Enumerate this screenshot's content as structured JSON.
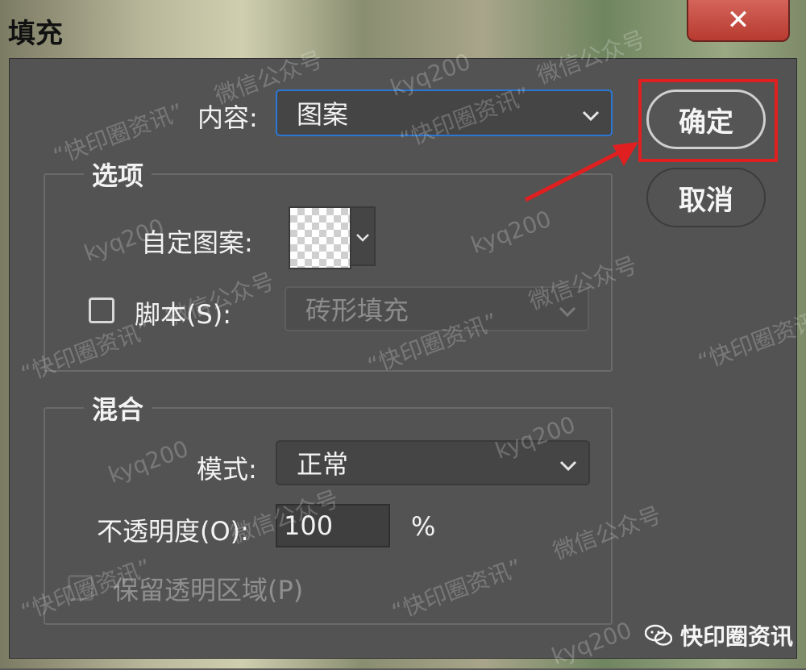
{
  "window": {
    "title": "填充",
    "close_symbol": "✕"
  },
  "content": {
    "label": "内容:",
    "value": "图案"
  },
  "options": {
    "group_title": "选项",
    "custom_pattern_label": "自定图案:",
    "script_label": "脚本(S):",
    "script_value": "砖形填充",
    "script_checked": false
  },
  "blend": {
    "group_title": "混合",
    "mode_label": "模式:",
    "mode_value": "正常",
    "opacity_label": "不透明度(O):",
    "opacity_value": "100",
    "opacity_unit": "%",
    "preserve_label": "保留透明区域(P)"
  },
  "buttons": {
    "ok": "确定",
    "cancel": "取消"
  },
  "watermarks": {
    "handle": "kyq200",
    "public": "微信公众号",
    "quote": "“快印圈资讯”"
  },
  "brand": {
    "name": "快印圈资讯"
  },
  "colors": {
    "highlight": "#e02020",
    "focus": "#2b78d4"
  }
}
